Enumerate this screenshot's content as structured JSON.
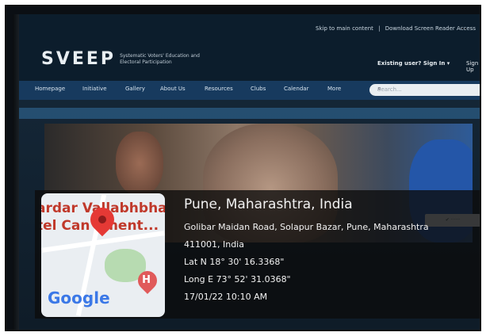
{
  "site": {
    "logo": "SVEEP",
    "logo_subtitle": "Systematic Voters' Education and Electoral Participation",
    "skip_link": "Skip to main content",
    "download_link": "Download Screen Reader Access",
    "existing_user": "Existing user? Sign In",
    "sign_up": "Sign Up",
    "nav": [
      "Homepage",
      "Initiative",
      "Gallery",
      "About Us",
      "Resources",
      "Clubs",
      "Calendar",
      "More"
    ],
    "search_placeholder": "Search..."
  },
  "geotag": {
    "location_title": "Pune, Maharashtra, India",
    "address_line1": "Golibar Maidan Road, Solapur Bazar, Pune, Maharashtra",
    "address_line2": "411001, India",
    "latitude": "Lat N 18° 30' 16.3368\"",
    "longitude": "Long E 73° 52' 31.0368\"",
    "timestamp": "17/01/22 10:10 AM",
    "map_label": "ardar Vallabhbhai\ntel Can    ment...",
    "map_brand": "Google"
  },
  "colors": {
    "nav_bg": "#173a5e",
    "pin": "#e53935",
    "google_blue": "#3b78e7"
  }
}
